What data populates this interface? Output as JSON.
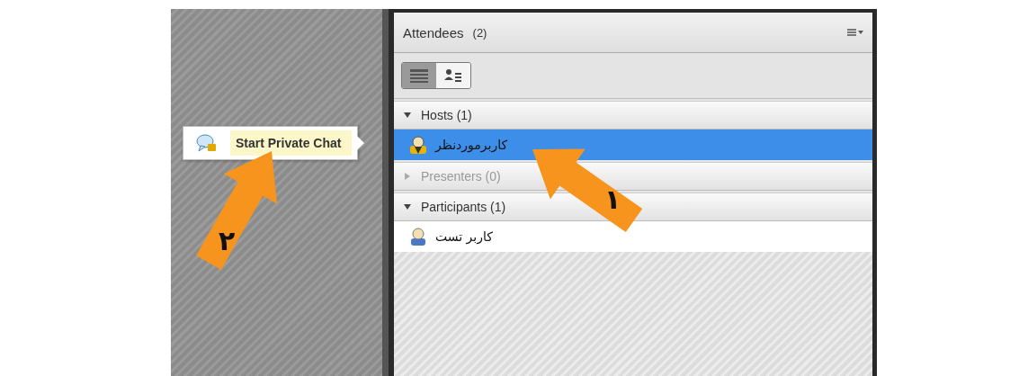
{
  "panel": {
    "title": "Attendees",
    "count": "(2)"
  },
  "view_buttons": [
    {
      "kind": "list",
      "selected": true
    },
    {
      "kind": "detail",
      "selected": false
    }
  ],
  "groups": [
    {
      "label": "Hosts (1)",
      "expanded": true,
      "disabled": false,
      "children": [
        {
          "name": "کاربرموردنظر",
          "kind": "host",
          "selected": true
        }
      ]
    },
    {
      "label": "Presenters (0)",
      "expanded": false,
      "disabled": true
    },
    {
      "label": "Participants (1)",
      "expanded": true,
      "disabled": false,
      "children": [
        {
          "name": "کاربر تست",
          "kind": "participant",
          "selected": false
        }
      ]
    }
  ],
  "context_menu": {
    "items": [
      {
        "label": "Start Private Chat",
        "highlighted": true
      }
    ]
  },
  "annotations": [
    {
      "label": "۱"
    },
    {
      "label": "۲"
    }
  ]
}
